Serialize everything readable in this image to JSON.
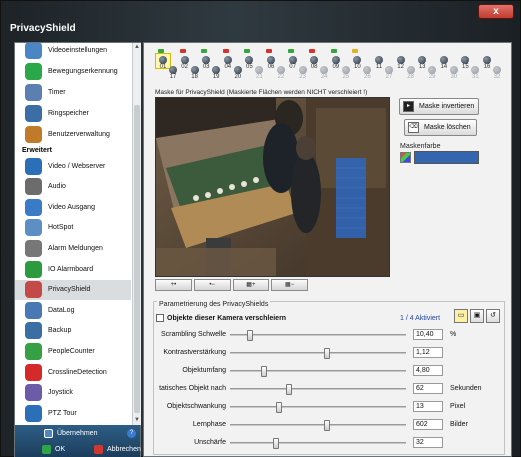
{
  "window": {
    "title": "PrivacyShield",
    "close_label": "x"
  },
  "sidebar": {
    "items_top": [
      {
        "label": "Videoeinstellungen",
        "icon": "video-settings-icon",
        "color": "#4a86c6"
      },
      {
        "label": "Bewegungserkennung",
        "icon": "running-person-icon",
        "color": "#2aa84a"
      },
      {
        "label": "Timer",
        "icon": "clock-icon",
        "color": "#5b7fb0"
      },
      {
        "label": "Ringspeicher",
        "icon": "ring-storage-icon",
        "color": "#3a6ea5"
      },
      {
        "label": "Benutzerverwaltung",
        "icon": "users-icon",
        "color": "#c07a2a"
      }
    ],
    "section_label": "Erweitert",
    "items": [
      {
        "label": "Video / Webserver",
        "icon": "globe-icon",
        "color": "#2b6fb8"
      },
      {
        "label": "Audio",
        "icon": "speaker-icon",
        "color": "#6c6c6c"
      },
      {
        "label": "Video Ausgang",
        "icon": "video-output-icon",
        "color": "#3a7bc8"
      },
      {
        "label": "HotSpot",
        "icon": "hotspot-icon",
        "color": "#5d8fc4"
      },
      {
        "label": "Alarm Meldungen",
        "icon": "alarm-icon",
        "color": "#777777"
      },
      {
        "label": "IO Alarmboard",
        "icon": "io-board-icon",
        "color": "#2d9a3f"
      },
      {
        "label": "PrivacyShield",
        "icon": "privacy-shield-icon",
        "color": "#c44a4a"
      },
      {
        "label": "DataLog",
        "icon": "datalog-icon",
        "color": "#4a78b5"
      },
      {
        "label": "Backup",
        "icon": "backup-icon",
        "color": "#3a6ea5"
      },
      {
        "label": "PeopleCounter",
        "icon": "people-counter-icon",
        "color": "#36a045"
      },
      {
        "label": "CrosslineDetection",
        "icon": "crossline-icon",
        "color": "#d42a2a"
      },
      {
        "label": "Joystick",
        "icon": "joystick-icon",
        "color": "#6c5ca8"
      },
      {
        "label": "PTZ Tour",
        "icon": "ptz-tour-icon",
        "color": "#2b6fb8"
      }
    ],
    "apply_label": "Übernehmen",
    "ok_label": "OK",
    "cancel_label": "Abbrechen",
    "help_label": "?"
  },
  "cameras": {
    "top": [
      "01",
      "02",
      "03",
      "04",
      "05",
      "06",
      "07",
      "08",
      "09",
      "10",
      "11",
      "12",
      "13",
      "14",
      "15",
      "16"
    ],
    "bottom": [
      "17",
      "18",
      "19",
      "20",
      "21",
      "22",
      "23",
      "24",
      "25",
      "26",
      "27",
      "28",
      "29",
      "30",
      "31",
      "32"
    ],
    "selected": "01",
    "red_flag_cams": [
      "02",
      "04",
      "06",
      "08"
    ],
    "green_flag_cams": [
      "01",
      "03",
      "05",
      "07",
      "09"
    ],
    "yellow_flag_cams": [
      "10"
    ]
  },
  "mask": {
    "label": "Maske für PrivacyShield (Maskierte Flächen werden NICHT verschleiert !)",
    "tools": [
      "+•",
      "•−",
      "▦+",
      "▦−"
    ],
    "invert_label": "Maske invertieren",
    "clear_label": "Maske löschen",
    "color_label": "Maskenfarbe",
    "color": "#3466b0"
  },
  "params": {
    "title": "Parametrierung des PrivacyShields",
    "checkbox_label": "Objekte dieser Kamera verschleiern",
    "active_text": "1 / 4 Aktiviert",
    "rows": [
      {
        "label": "Scrambling Schwelle",
        "value": "10,40",
        "unit": "%",
        "level": 0.1
      },
      {
        "label": "Kontrastverstärkung",
        "value": "1,12",
        "unit": "",
        "level": 0.55
      },
      {
        "label": "Objektumfang",
        "value": "4,80",
        "unit": "",
        "level": 0.18
      },
      {
        "label": "tatisches Objekt nach",
        "value": "62",
        "unit": "Sekunden",
        "level": 0.33
      },
      {
        "label": "Objektschwankung",
        "value": "13",
        "unit": "Pixel",
        "level": 0.27
      },
      {
        "label": "Lernphase",
        "value": "602",
        "unit": "Bilder",
        "level": 0.55
      },
      {
        "label": "Unschärfe",
        "value": "32",
        "unit": "",
        "level": 0.25
      }
    ]
  }
}
